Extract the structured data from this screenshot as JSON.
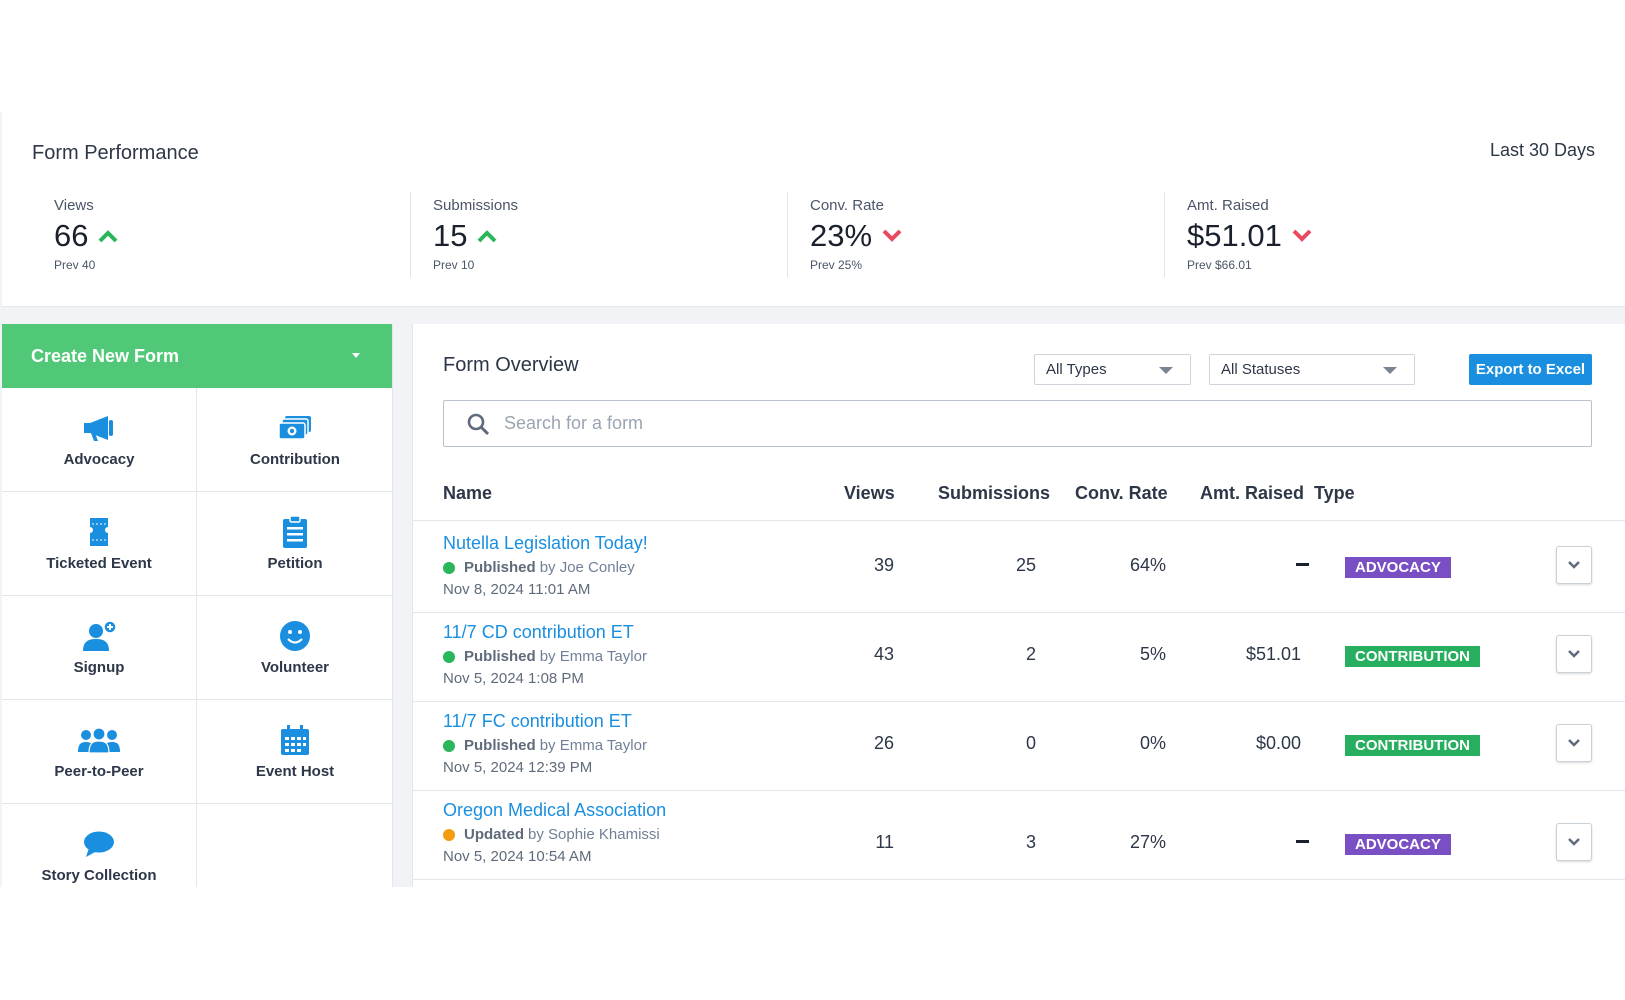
{
  "performance": {
    "title": "Form Performance",
    "range": "Last 30 Days",
    "metrics": [
      {
        "label": "Views",
        "value": "66",
        "trend": "up",
        "prev": "Prev 40"
      },
      {
        "label": "Submissions",
        "value": "15",
        "trend": "up",
        "prev": "Prev 10"
      },
      {
        "label": "Conv. Rate",
        "value": "23%",
        "trend": "down",
        "prev": "Prev 25%"
      },
      {
        "label": "Amt. Raised",
        "value": "$51.01",
        "trend": "down",
        "prev": "Prev $66.01"
      }
    ]
  },
  "sidebar": {
    "create_label": "Create New Form",
    "tiles": [
      {
        "label": "Advocacy",
        "icon": "megaphone-icon"
      },
      {
        "label": "Contribution",
        "icon": "money-icon"
      },
      {
        "label": "Ticketed Event",
        "icon": "ticket-icon"
      },
      {
        "label": "Petition",
        "icon": "clipboard-icon"
      },
      {
        "label": "Signup",
        "icon": "user-add-icon"
      },
      {
        "label": "Volunteer",
        "icon": "smiley-icon"
      },
      {
        "label": "Peer-to-Peer",
        "icon": "group-icon"
      },
      {
        "label": "Event Host",
        "icon": "calendar-icon"
      },
      {
        "label": "Story Collection",
        "icon": "speech-bubble-icon"
      }
    ]
  },
  "overview": {
    "title": "Form Overview",
    "type_filter": "All Types",
    "status_filter": "All Statuses",
    "export_label": "Export to Excel",
    "search_placeholder": "Search for a form",
    "columns": {
      "name": "Name",
      "views": "Views",
      "submissions": "Submissions",
      "conv_rate": "Conv. Rate",
      "amt_raised": "Amt. Raised",
      "type": "Type"
    },
    "rows": [
      {
        "name": "Nutella Legislation Today!",
        "status": "Published",
        "by": "by Joe Conley",
        "date": "Nov 8, 2024 11:01 AM",
        "views": "39",
        "submissions": "25",
        "conv_rate": "64%",
        "amt_raised": "",
        "type": "ADVOCACY",
        "status_color": "#2ab65a",
        "type_color": "#7b4fc4"
      },
      {
        "name": "11/7 CD contribution ET",
        "status": "Published",
        "by": "by Emma Taylor",
        "date": "Nov 5, 2024 1:08 PM",
        "views": "43",
        "submissions": "2",
        "conv_rate": "5%",
        "amt_raised": "$51.01",
        "type": "CONTRIBUTION",
        "status_color": "#2ab65a",
        "type_color": "#27ae5f"
      },
      {
        "name": "11/7 FC contribution ET",
        "status": "Published",
        "by": "by Emma Taylor",
        "date": "Nov 5, 2024 12:39 PM",
        "views": "26",
        "submissions": "0",
        "conv_rate": "0%",
        "amt_raised": "$0.00",
        "type": "CONTRIBUTION",
        "status_color": "#2ab65a",
        "type_color": "#27ae5f"
      },
      {
        "name": "Oregon Medical Association",
        "status": "Updated",
        "by": "by Sophie Khamissi",
        "date": "Nov 5, 2024 10:54 AM",
        "views": "11",
        "submissions": "3",
        "conv_rate": "27%",
        "amt_raised": "",
        "type": "ADVOCACY",
        "status_color": "#f39c12",
        "type_color": "#7b4fc4"
      }
    ]
  },
  "colors": {
    "accent": "#1a8fe0",
    "create": "#50c878",
    "up": "#2ab65a",
    "down": "#e84a5f"
  }
}
